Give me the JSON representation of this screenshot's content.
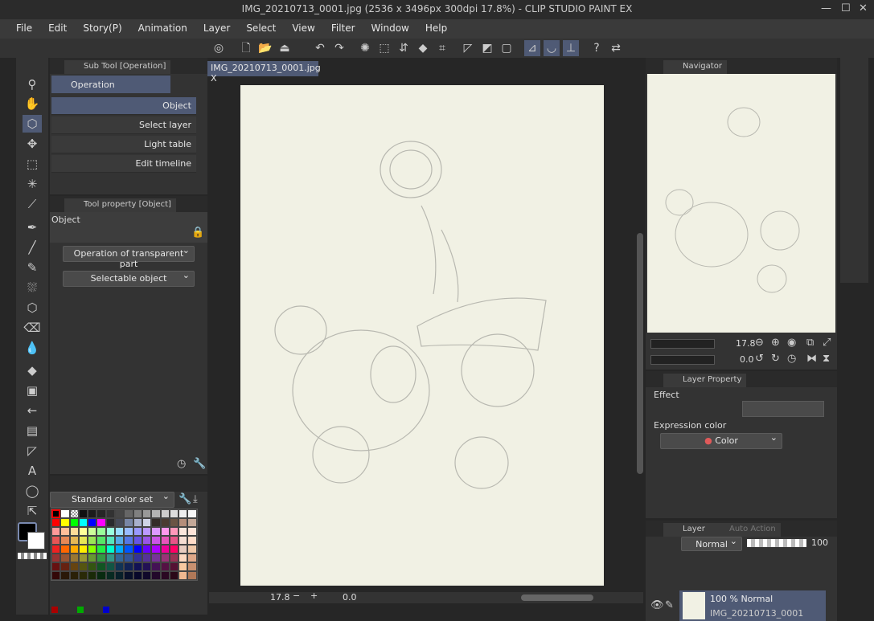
{
  "window": {
    "title": "IMG_20210713_0001.jpg (2536 x 3496px 300dpi 17.8%)  - CLIP STUDIO PAINT EX",
    "minimize": "—",
    "maximize": "☐",
    "close": "✕"
  },
  "menu": [
    "File",
    "Edit",
    "Story(P)",
    "Animation",
    "Layer",
    "Select",
    "View",
    "Filter",
    "Window",
    "Help"
  ],
  "subtool": {
    "tab": "Sub Tool [Operation]",
    "group": "Operation",
    "items": [
      "Object",
      "Select layer",
      "Light table",
      "Edit timeline"
    ]
  },
  "toolprop": {
    "tab": "Tool property [Object]",
    "name": "Object",
    "dropdown1": "Operation of transparent part",
    "dropdown2": "Selectable object"
  },
  "colorset": {
    "name": "Standard color set",
    "colors": [
      [
        "#000000",
        "#ffffff",
        "checker",
        "#111111",
        "#1c1c1c",
        "#262626",
        "#323232",
        "#474747",
        "#666666",
        "#808080",
        "#999999",
        "#b3b3b3",
        "#cccccc",
        "#dcdcdc",
        "#eeeeee",
        "#f7f7f7"
      ],
      [
        "#ff0000",
        "#ffff00",
        "#00ff00",
        "#00ffff",
        "#0000ff",
        "#ff00ff",
        "#2a2a2e",
        "#464a58",
        "#7886a6",
        "#a8b0cc",
        "#cfd4e6",
        "#332c28",
        "#4a3c32",
        "#6a5444",
        "#b58e7a",
        "#c4a898"
      ],
      [
        "#ff9999",
        "#ffbf99",
        "#ffdd99",
        "#ffff99",
        "#ccff99",
        "#99ff99",
        "#99ffdd",
        "#99ddff",
        "#99bbff",
        "#9999ff",
        "#bb99ff",
        "#dd99ff",
        "#ff99ee",
        "#ff99bb",
        "#fbe6dc",
        "#ffe4d8"
      ],
      [
        "#e65555",
        "#e68855",
        "#e6b855",
        "#e6e655",
        "#99e655",
        "#55e666",
        "#55e6bb",
        "#55aae6",
        "#5577e6",
        "#6655e6",
        "#9955e6",
        "#cc55e6",
        "#e655bb",
        "#e65588",
        "#f5ddd2",
        "#ffdcc8"
      ],
      [
        "#ee2222",
        "#ff6600",
        "#ffaa00",
        "#ffee00",
        "#88ff00",
        "#22ee44",
        "#00ffcc",
        "#00aaff",
        "#0055ff",
        "#0000ff",
        "#6600ff",
        "#aa00ff",
        "#ee0099",
        "#ff0066",
        "#e8ccc0",
        "#f0c8a8"
      ],
      [
        "#993333",
        "#995533",
        "#997733",
        "#999933",
        "#669933",
        "#339944",
        "#339988",
        "#336699",
        "#335599",
        "#333399",
        "#553399",
        "#773399",
        "#993377",
        "#993355",
        "#fcd8c0",
        "#e0a888"
      ],
      [
        "#661111",
        "#662211",
        "#664411",
        "#555511",
        "#335511",
        "#115522",
        "#115544",
        "#113355",
        "#112255",
        "#111155",
        "#221155",
        "#441155",
        "#551144",
        "#551133",
        "#f8c8a0",
        "#c89070"
      ],
      [
        "#330808",
        "#2a1808",
        "#2a2008",
        "#2a2a08",
        "#1a2a08",
        "#082a10",
        "#082a22",
        "#08202a",
        "#08102a",
        "#08082a",
        "#10082a",
        "#22082a",
        "#2a0822",
        "#2a0818",
        "#f0b890",
        "#b07858"
      ]
    ],
    "recent": [
      "#aa0000",
      "#00aa00",
      "#0000cc"
    ]
  },
  "document": {
    "tab": "IMG_20210713_0001.jpg",
    "close": "X",
    "zoom": "17.8",
    "rotation": "0.0"
  },
  "navigator": {
    "tab": "Navigator",
    "zoom": "17.8",
    "angle": "0.0"
  },
  "layerprop": {
    "tab": "Layer Property",
    "effect": "Effect",
    "expression_color": "Expression color",
    "color_mode": "Color"
  },
  "layer": {
    "tab": "Layer",
    "tab2": "Auto Action",
    "blend": "Normal",
    "opacity": "100",
    "item_mode": "100 % Normal",
    "item_name": "IMG_20210713_0001"
  }
}
